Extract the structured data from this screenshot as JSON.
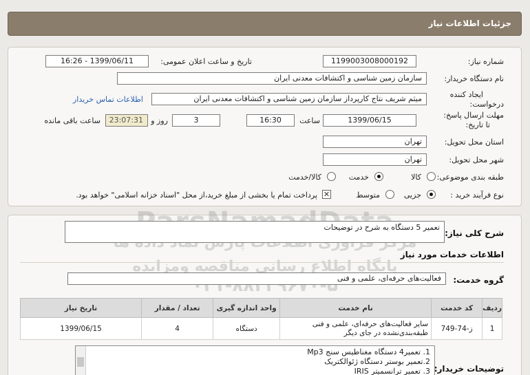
{
  "header": {
    "title": "جزئیات اطلاعات نیاز"
  },
  "fields": {
    "need_number_label": "شماره نیاز:",
    "need_number": "1199003008000192",
    "announce_label": "تاریخ و ساعت اعلان عمومی:",
    "announce_value": "1399/06/11 - 16:26",
    "buyer_org_label": "نام دستگاه خریدار:",
    "buyer_org": "سازمان زمین شناسی و اکتشافات معدنی ایران",
    "creator_label_1": "ایجاد کننده",
    "creator_label_2": "درخواست:",
    "creator": "میثم شریف نتاج کارپرداز سازمان زمین شناسی و اکتشافات معدنی ایران",
    "contact_link": "اطلاعات تماس خریدار",
    "deadline_label_1": "مهلت ارسال پاسخ:",
    "deadline_label_2": "تا تاریخ:",
    "deadline_date": "1399/06/15",
    "time_label": "ساعت",
    "deadline_time": "16:30",
    "days_value": "3",
    "days_label": "روز و",
    "remaining_time": "23:07:31",
    "remaining_label": "ساعت باقی مانده",
    "province_label": "استان محل تحویل:",
    "province": "تهران",
    "city_label": "شهر محل تحویل:",
    "city": "تهران",
    "category_label": "طبقه بندی موضوعی:",
    "category_options": [
      "کالا",
      "خدمت",
      "کالا/خدمت"
    ],
    "process_label": "نوع فرآیند خرید :",
    "process_options": [
      "جزیی",
      "متوسط"
    ],
    "payment_note": "پرداخت تمام یا بخشی از مبلغ خرید،از محل \"اسناد خزانه اسلامی\" خواهد بود."
  },
  "summary": {
    "label": "شرح کلی نیاز:",
    "value": "تعمیر 5 دستگاه به شرح در توضیحات"
  },
  "services_title": "اطلاعات خدمات مورد نیاز",
  "service_group": {
    "label": "گروه خدمت:",
    "value": "فعالیت‌های حرفه‌ای، علمی و فنی"
  },
  "table": {
    "headers": [
      "ردیف",
      "کد خدمت",
      "نام خدمت",
      "واحد اندازه گیری",
      "تعداد / مقدار",
      "تاریخ نیاز"
    ],
    "rows": [
      [
        "1",
        "ز-74-749",
        "سایر فعالیت‌های حرفه‌ای، علمی و فنی طبقه‌بندی‌نشده در جای دیگر",
        "دستگاه",
        "4",
        "1399/06/15"
      ]
    ]
  },
  "buyer_notes": {
    "label": "توضیحات خریدار:",
    "lines": [
      "1. تعمیر4 دستگاه مغناطیس سنج Mp3",
      "2.تعمیر بوستر دستگاه ژئوالکتریک",
      "3. تعمیر ترانسمیتر IRIS"
    ]
  },
  "watermark": {
    "brand": "ParsNamadData",
    "line1": "مرکز فراوری اطلاعات پارس نماد داده ها",
    "line2": "پایگاه اطلاع رسانی مناقصه ومزایده",
    "phone": "۰۲۱-۸۸۳۴۹۶۷۰-۵"
  }
}
